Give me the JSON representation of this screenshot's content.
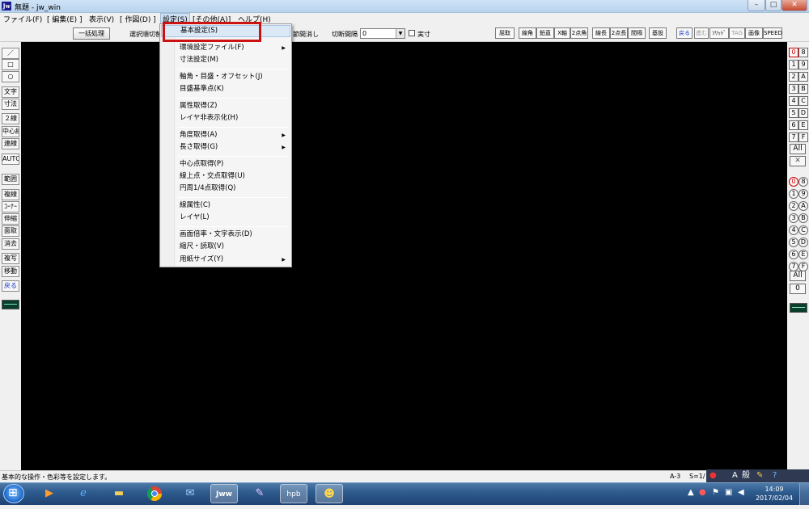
{
  "window": {
    "title": "無題 - jw_win",
    "app_icon": "Jw",
    "min": "–",
    "max": "□",
    "close": "✕"
  },
  "menubar": [
    "ファイル(F)",
    "[ 編集(E) ]",
    "表示(V)",
    "[ 作図(D) ]",
    "設定(S)",
    "[その他(A)]",
    "ヘルプ(H)"
  ],
  "controlbar": {
    "bulk_process": "一括処理",
    "select_order": "選択順切替",
    "node_erase": "節間消し",
    "cut_interval_label": "切断間隔",
    "cut_interval_value": "0",
    "actual_size": "実寸"
  },
  "toolbar_right": [
    "屈取",
    "線角",
    "鉛直",
    "X軸",
    "2点角",
    "線長",
    "2点長",
    "間隔",
    "基設",
    "戻る",
    "進む",
    "ｿﾘｯﾄﾞ",
    "TAG",
    "画像",
    "SPEED"
  ],
  "left_tools": [
    "／",
    "□",
    "○",
    "文字",
    "寸法",
    "２線",
    "中心線",
    "連線",
    "AUTO",
    "範囲",
    "複線",
    "ｺｰﾅｰ",
    "伸縮",
    "面取",
    "消去",
    "複写",
    "移動",
    "戻る"
  ],
  "layer_groups": [
    [
      "0",
      "8"
    ],
    [
      "1",
      "9"
    ],
    [
      "2",
      "A"
    ],
    [
      "3",
      "B"
    ],
    [
      "4",
      "C"
    ],
    [
      "5",
      "D"
    ],
    [
      "6",
      "E"
    ],
    [
      "7",
      "F"
    ]
  ],
  "layer_all": "All",
  "layer_x": "✕",
  "layers": [
    [
      "0",
      "8"
    ],
    [
      "1",
      "9"
    ],
    [
      "2",
      "A"
    ],
    [
      "3",
      "B"
    ],
    [
      "4",
      "C"
    ],
    [
      "5",
      "D"
    ],
    [
      "6",
      "E"
    ],
    [
      "7",
      "F"
    ]
  ],
  "layers_all": "All",
  "layers_zero": "0",
  "dropdown": {
    "items": [
      {
        "label": "基本設定(S)",
        "sub": false
      },
      {
        "label": "環境設定ファイル(F)",
        "sub": true
      },
      {
        "label": "寸法設定(M)",
        "sub": false
      },
      {
        "label": "軸角・目盛・オフセット(J)",
        "sub": false
      },
      {
        "label": "目盛基準点(K)",
        "sub": false
      },
      {
        "label": "属性取得(Z)",
        "sub": false
      },
      {
        "label": "レイヤ非表示化(H)",
        "sub": false
      },
      {
        "label": "角度取得(A)",
        "sub": true
      },
      {
        "label": "長さ取得(G)",
        "sub": true
      },
      {
        "label": "中心点取得(P)",
        "sub": false
      },
      {
        "label": "線上点・交点取得(U)",
        "sub": false
      },
      {
        "label": "円周1/4点取得(Q)",
        "sub": false
      },
      {
        "label": "線属性(C)",
        "sub": false
      },
      {
        "label": "レイヤ(L)",
        "sub": false
      },
      {
        "label": "画面倍率・文字表示(D)",
        "sub": false
      },
      {
        "label": "縮尺・読取(V)",
        "sub": false
      },
      {
        "label": "用紙サイズ(Y)",
        "sub": true
      }
    ],
    "submenu_arrow": "▶"
  },
  "status": {
    "text": "基本的な操作・色彩等を設定します。",
    "paper": "A-3",
    "scale": "S=1/"
  },
  "ime": {
    "mode": "A",
    "kana": "般"
  },
  "taskbar": {
    "time": "14:09",
    "date": "2017/02/04",
    "apps": [
      "media-player",
      "internet-explorer",
      "file-explorer",
      "chrome",
      "thunderbird",
      "jw-cad",
      "paint",
      "hpb",
      "game"
    ],
    "jw_label": "Jww",
    "hpb_label": "hpb"
  }
}
